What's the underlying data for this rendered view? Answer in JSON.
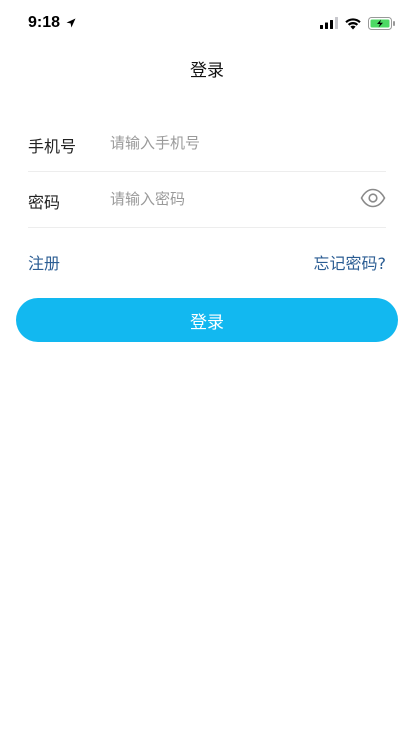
{
  "status_bar": {
    "time": "9:18",
    "icons": [
      "location-arrow-icon",
      "signal-icon",
      "wifi-icon",
      "battery-charging-icon"
    ]
  },
  "header": {
    "title": "登录"
  },
  "form": {
    "phone": {
      "label": "手机号",
      "placeholder": "请输入手机号",
      "value": ""
    },
    "password": {
      "label": "密码",
      "placeholder": "请输入密码",
      "value": "",
      "toggle_icon": "eye-icon"
    }
  },
  "links": {
    "register": "注册",
    "forgot_password": "忘记密码?"
  },
  "actions": {
    "login_label": "登录"
  },
  "colors": {
    "primary_button": "#12b8f0",
    "link": "#2b5d93",
    "battery_charge": "#4cd964"
  }
}
